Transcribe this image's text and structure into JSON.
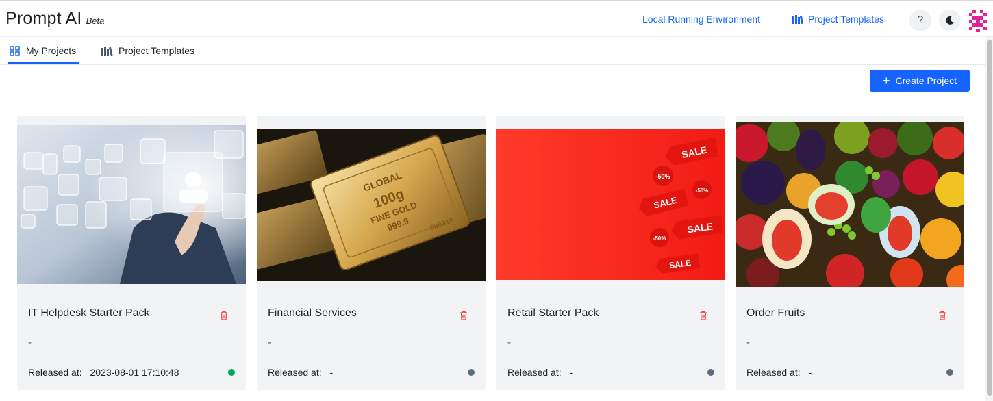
{
  "app": {
    "name": "Prompt AI",
    "badge": "Beta"
  },
  "header": {
    "env_link": "Local Running Environment",
    "templates_link": "Project Templates",
    "help_label": "?"
  },
  "tabs": [
    {
      "label": "My Projects",
      "active": true
    },
    {
      "label": "Project Templates",
      "active": false
    }
  ],
  "toolbar": {
    "create_label": "Create Project"
  },
  "colors": {
    "accent": "#1664ff",
    "danger": "#f53f3f",
    "online": "#00a84f",
    "offline": "#5d6b7b"
  },
  "projects": [
    {
      "title": "IT Helpdesk Starter Pack",
      "description": "-",
      "released_label": "Released at:",
      "released_value": "2023-08-01 17:10:48",
      "status": "online",
      "image": "helpdesk-image"
    },
    {
      "title": "Financial Services",
      "description": "-",
      "released_label": "Released at:",
      "released_value": "-",
      "status": "offline",
      "image": "gold-bars-image"
    },
    {
      "title": "Retail Starter Pack",
      "description": "-",
      "released_label": "Released at:",
      "released_value": "-",
      "status": "offline",
      "image": "sale-tags-image"
    },
    {
      "title": "Order Fruits",
      "description": "-",
      "released_label": "Released at:",
      "released_value": "-",
      "status": "offline",
      "image": "fruits-image"
    }
  ],
  "sale_tags": [
    "SALE",
    "-50%",
    "SALE",
    "-50%",
    "SALE",
    "-50%",
    "SALE"
  ],
  "gold_texts": [
    "GLOBAL",
    "100g",
    "FINE GOLD",
    "999.9",
    "G00010"
  ]
}
